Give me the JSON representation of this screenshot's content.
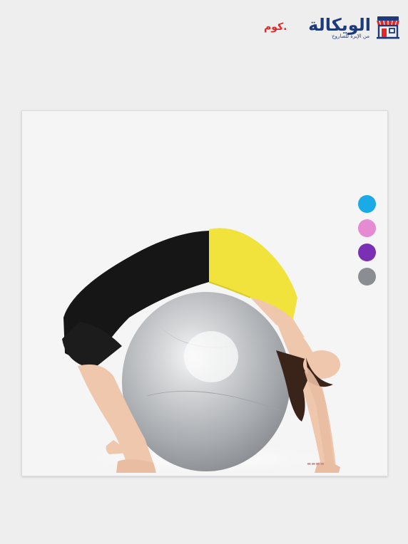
{
  "brand": {
    "name": "الويكالة",
    "domain_suffix": ".كوم",
    "tagline": "من الإبرة للصاروخ",
    "primary_color": "#1d3a7a",
    "accent_color": "#e02a2a",
    "icon": "storefront-icon"
  },
  "product": {
    "image_subject": "yoga-exercise-ball",
    "ball_color": "#b9bcc0",
    "color_options": [
      {
        "name": "blue",
        "hex": "#1aabe6"
      },
      {
        "name": "pink",
        "hex": "#e58ad3"
      },
      {
        "name": "purple",
        "hex": "#7a2fb5"
      },
      {
        "name": "gray",
        "hex": "#8a8d92"
      }
    ]
  }
}
